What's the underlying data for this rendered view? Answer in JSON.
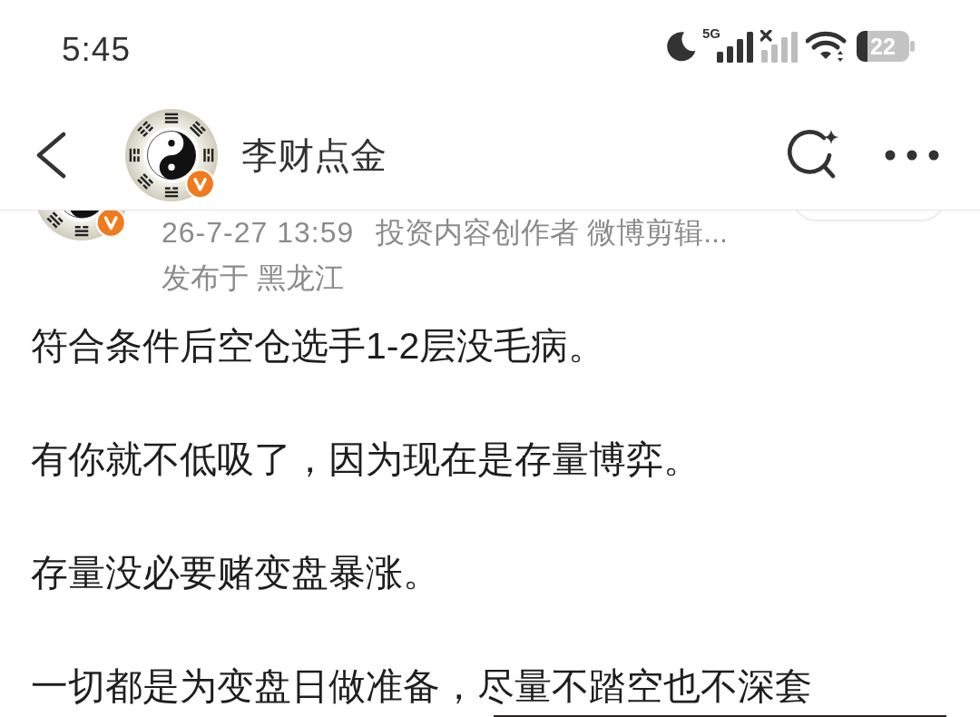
{
  "status_bar": {
    "time": "5:45",
    "network": "5G",
    "battery": "22"
  },
  "header": {
    "title": "李财点金",
    "verified": true
  },
  "post": {
    "verified": true,
    "date": "26-7-27 13:59",
    "source": "投资内容创作者 微博剪辑...",
    "location": "发布于 黑龙江",
    "paragraphs": [
      "符合条件后空仓选手1-2层没毛病。",
      "有你就不低吸了，因为现在是存量博弈。",
      "存量没必要赌变盘暴涨。",
      "一切都是为变盘日做准备，尽量不踏空也不深套"
    ]
  }
}
